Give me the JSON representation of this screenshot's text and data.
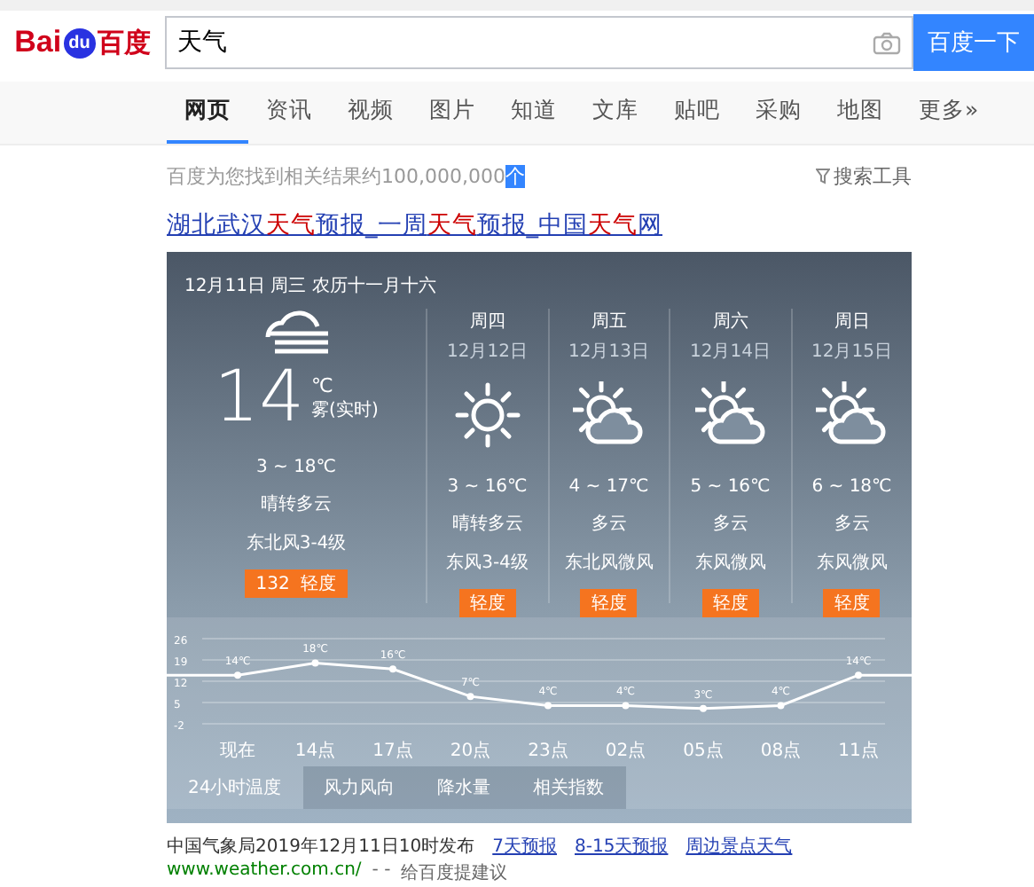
{
  "header": {
    "logo": {
      "left": "Bai",
      "paw": "du",
      "right": "百度"
    },
    "search": {
      "value": "天气"
    },
    "search_button": "百度一下"
  },
  "nav_tabs": [
    {
      "label": "网页",
      "selected": true
    },
    {
      "label": "资讯",
      "selected": false
    },
    {
      "label": "视频",
      "selected": false
    },
    {
      "label": "图片",
      "selected": false
    },
    {
      "label": "知道",
      "selected": false
    },
    {
      "label": "文库",
      "selected": false
    },
    {
      "label": "贴吧",
      "selected": false
    },
    {
      "label": "采购",
      "selected": false
    },
    {
      "label": "地图",
      "selected": false
    },
    {
      "label": "更多»",
      "selected": false
    }
  ],
  "result_count": {
    "text": "百度为您找到相关结果约100,000,000",
    "unit": "个",
    "unit_highlighted": true
  },
  "search_tools": "搜索工具",
  "result_title": [
    {
      "text": "湖北武汉",
      "highlight": false
    },
    {
      "text": "天气",
      "highlight": true
    },
    {
      "text": "预报_一周",
      "highlight": false
    },
    {
      "text": "天气",
      "highlight": true
    },
    {
      "text": "预报_中国",
      "highlight": false
    },
    {
      "text": "天气",
      "highlight": true
    },
    {
      "text": "网",
      "highlight": false
    }
  ],
  "weather": {
    "date": "12月11日 周三 农历十一月十六",
    "today": {
      "kind": "fog",
      "temp": "14",
      "unit": "℃",
      "condition": "雾(实时)",
      "range": "3 ~ 18℃",
      "forecast": "晴转多云",
      "wind": "东北风3-4级",
      "aqi": "132  轻度"
    },
    "days": [
      {
        "day": "周四",
        "date": "12月12日",
        "kind": "sun",
        "range": "3 ~ 16℃",
        "forecast": "晴转多云",
        "wind": "东风3-4级",
        "aqi": "轻度"
      },
      {
        "day": "周五",
        "date": "12月13日",
        "kind": "partly",
        "range": "4 ~ 17℃",
        "forecast": "多云",
        "wind": "东北风微风",
        "aqi": "轻度"
      },
      {
        "day": "周六",
        "date": "12月14日",
        "kind": "partly",
        "range": "5 ~ 16℃",
        "forecast": "多云",
        "wind": "东风微风",
        "aqi": "轻度"
      },
      {
        "day": "周日",
        "date": "12月15日",
        "kind": "partly",
        "range": "6 ~ 18℃",
        "forecast": "多云",
        "wind": "东风微风",
        "aqi": "轻度"
      }
    ],
    "chart_data": {
      "type": "line",
      "categories": [
        "现在",
        "14点",
        "17点",
        "20点",
        "23点",
        "02点",
        "05点",
        "08点",
        "11点"
      ],
      "series": [
        {
          "color": "#ffffff",
          "marker": "circle",
          "values": [
            14,
            18,
            16,
            7,
            4,
            4,
            3,
            4,
            14
          ]
        }
      ],
      "grid": true,
      "ylim": [
        -2,
        26
      ],
      "yticks": [
        26,
        19,
        12,
        5,
        -2
      ],
      "value_labels": [
        "14℃",
        "18℃",
        "16℃",
        "7℃",
        "4℃",
        "4℃",
        "3℃",
        "4℃",
        "14℃"
      ]
    },
    "chart_tabs": [
      {
        "label": "24小时温度",
        "selected": true
      },
      {
        "label": "风力风向",
        "selected": false
      },
      {
        "label": "降水量",
        "selected": false
      },
      {
        "label": "相关指数",
        "selected": false
      }
    ]
  },
  "source": {
    "text": "中国气象局2019年12月11日10时发布",
    "links": [
      "7天预报",
      "8-15天预报",
      "周边景点天气"
    ]
  },
  "url_line": {
    "url": "www.weather.com.cn/",
    "sep": "- -",
    "feedback": "给百度提建议"
  }
}
